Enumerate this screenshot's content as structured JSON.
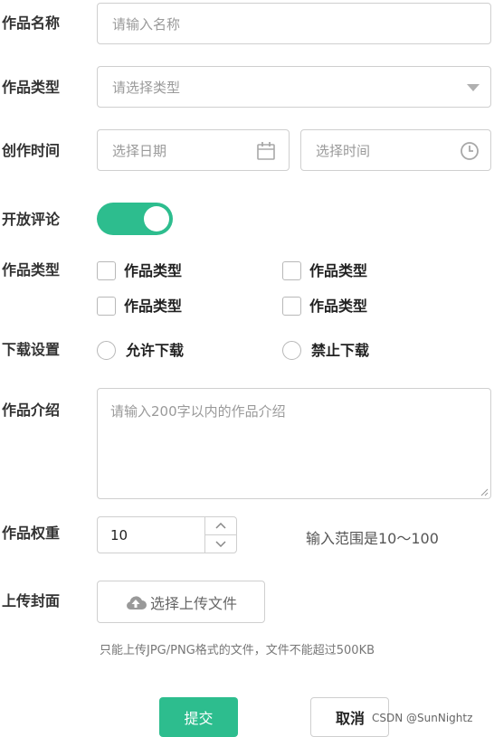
{
  "form": {
    "name": {
      "label": "作品名称",
      "placeholder": "请输入名称"
    },
    "type": {
      "label": "作品类型",
      "placeholder": "请选择类型"
    },
    "time": {
      "label": "创作时间",
      "date_placeholder": "选择日期",
      "time_placeholder": "选择时间"
    },
    "comment": {
      "label": "开放评论",
      "enabled": true
    },
    "categories": {
      "label": "作品类型",
      "options": [
        "作品类型",
        "作品类型",
        "作品类型",
        "作品类型"
      ]
    },
    "download": {
      "label": "下载设置",
      "options": [
        "允许下载",
        "禁止下载"
      ]
    },
    "intro": {
      "label": "作品介绍",
      "placeholder": "请输入200字以内的作品介绍"
    },
    "weight": {
      "label": "作品权重",
      "value": "10",
      "hint": "输入范围是10～100"
    },
    "cover": {
      "label": "上传封面",
      "button_label": "选择上传文件",
      "hint": "只能上传JPG/PNG格式的文件，文件不能超过500KB"
    },
    "actions": {
      "submit": "提交",
      "cancel": "取消"
    }
  },
  "watermark": "CSDN @SunNightz",
  "colors": {
    "accent": "#2dbd8e",
    "border": "#cfcfcf",
    "placeholder": "#9a9a9a"
  }
}
